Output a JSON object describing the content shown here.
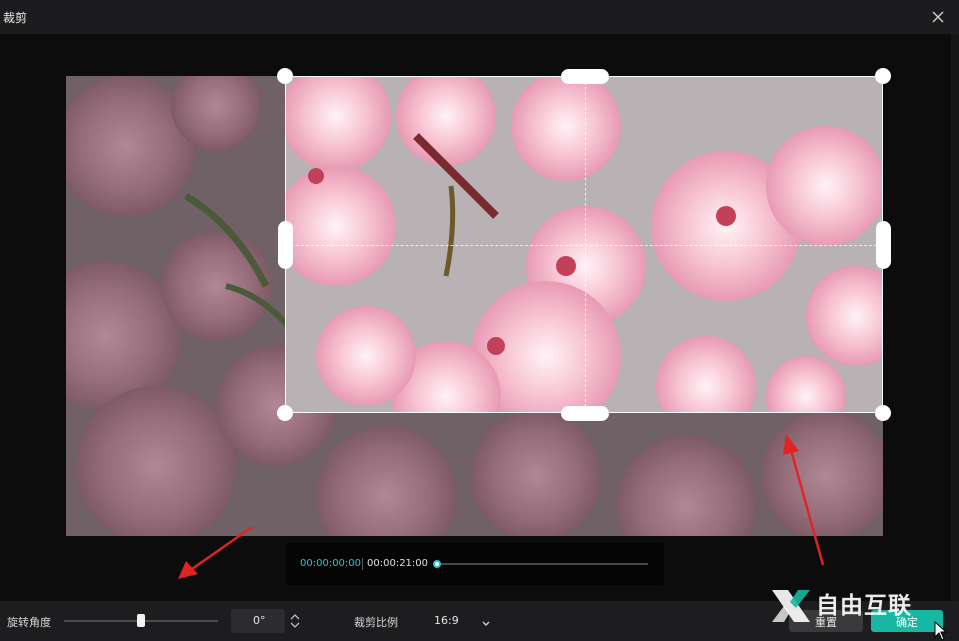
{
  "window": {
    "title": "裁剪",
    "close_icon": "close-icon"
  },
  "preview": {
    "image_subject": "cherry-blossom-photo",
    "crop_handles": [
      "top-left",
      "top",
      "top-right",
      "left",
      "right",
      "bottom-left",
      "bottom",
      "bottom-right"
    ]
  },
  "timeline": {
    "current_time": "00:00:00:00",
    "total_time": "00:00:21:00",
    "progress": 0,
    "accent_color": "#29c4d3"
  },
  "controls": {
    "rotation_label": "旋转角度",
    "rotation_value": "0°",
    "crop_ratio_label": "裁剪比例",
    "crop_ratio_value": "16:9",
    "reset_label": "重置",
    "confirm_label": "确定",
    "confirm_color": "#18b7a3"
  },
  "watermark": {
    "text": "自由互联"
  }
}
